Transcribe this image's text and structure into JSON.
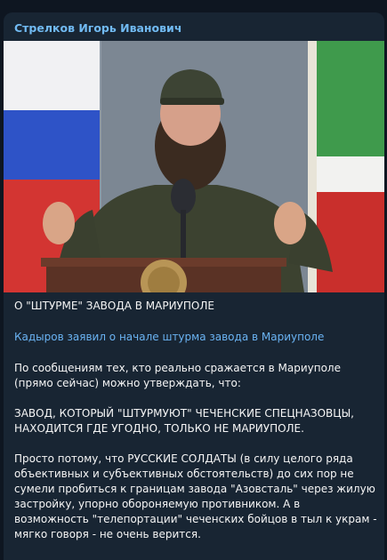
{
  "message": {
    "sender": "Стрелков Игорь Иванович",
    "heading": "О \"ШТУРМЕ\" ЗАВОДА В МАРИУПОЛЕ",
    "link_text": "Кадыров заявил о начале штурма завода в Мариуполе",
    "paragraphs": [
      "По сообщениям тех, кто реально сражается в Мариуполе\n(прямо сейчас) можно утверждать, что:",
      "ЗАВОД, КОТОРЫЙ \"ШТУРМУЮТ\" ЧЕЧЕНСКИЕ СПЕЦНАЗОВЦЫ,\nНАХОДИТСЯ ГДЕ УГОДНО, ТОЛЬКО НЕ МАРИУПОЛЕ.",
      "Просто потому, что РУССКИЕ СОЛДАТЫ (в силу целого ряда\nобъективных и субъективных обстоятельств) до сих пор не\nсумели пробиться к границам завода \"Азовсталь\" через жилую\nзастройку, упорно обороняемую противником. А в\nвозможность \"телепортации\" чеченских бойцов в тыл к украм -\nмягко говоря - не очень верится."
    ]
  },
  "colors": {
    "background": "#0e1621",
    "bubble": "#182533",
    "sender": "#71baf2",
    "link": "#6ab3f3",
    "text": "#f5f5f5"
  }
}
